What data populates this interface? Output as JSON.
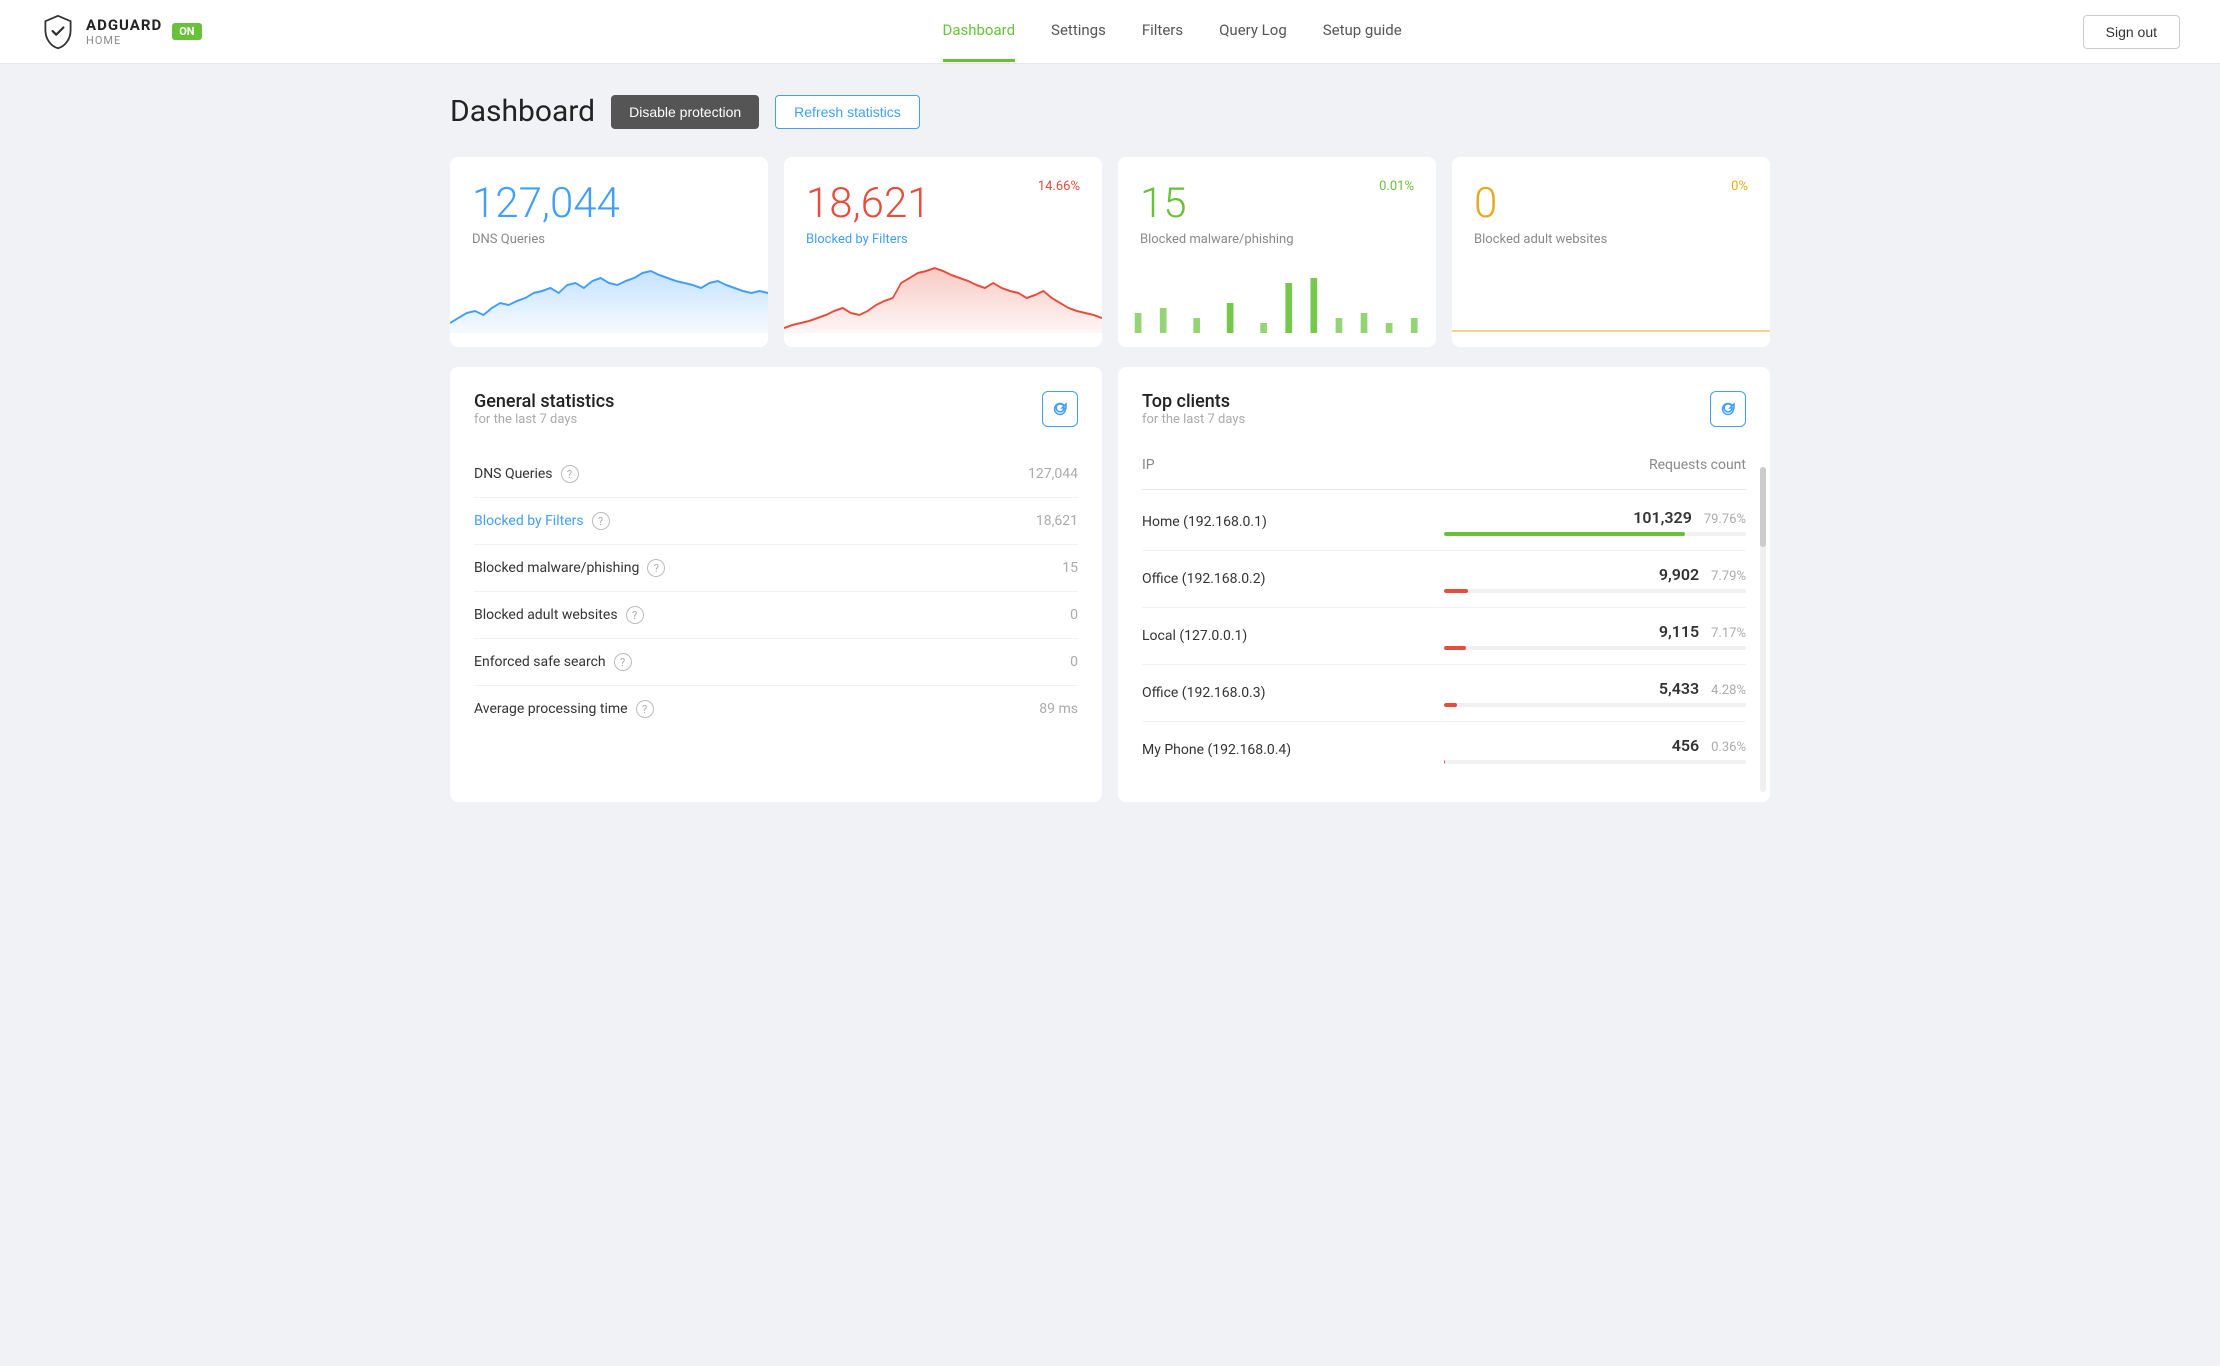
{
  "header": {
    "logo_name": "ADGUARD",
    "logo_sub": "HOME",
    "badge": "ON",
    "nav": [
      {
        "label": "Dashboard",
        "active": true
      },
      {
        "label": "Settings",
        "active": false
      },
      {
        "label": "Filters",
        "active": false
      },
      {
        "label": "Query Log",
        "active": false
      },
      {
        "label": "Setup guide",
        "active": false
      }
    ],
    "sign_out": "Sign out"
  },
  "page": {
    "title": "Dashboard",
    "btn_disable": "Disable protection",
    "btn_refresh": "Refresh statistics"
  },
  "stat_cards": [
    {
      "id": "dns-queries",
      "number": "127,044",
      "number_color": "blue",
      "percent": "",
      "percent_color": "",
      "label": "DNS Queries",
      "label_color": "",
      "chart_color": "#409eff",
      "chart_fill": "#ddeeff"
    },
    {
      "id": "blocked-filters",
      "number": "18,621",
      "number_color": "red",
      "percent": "14.66%",
      "percent_color": "red",
      "label": "Blocked by Filters",
      "label_color": "blue",
      "chart_color": "#e74c3c",
      "chart_fill": "#fde8e8"
    },
    {
      "id": "blocked-malware",
      "number": "15",
      "number_color": "green",
      "percent": "0.01%",
      "percent_color": "green",
      "label": "Blocked malware/phishing",
      "label_color": "",
      "chart_color": "#67c23a",
      "chart_fill": "#e8f8df"
    },
    {
      "id": "blocked-adult",
      "number": "0",
      "number_color": "yellow",
      "percent": "0%",
      "percent_color": "yellow",
      "label": "Blocked adult websites",
      "label_color": "",
      "chart_color": "#e6a817",
      "chart_fill": "#fdf3dc"
    }
  ],
  "general_stats": {
    "title": "General statistics",
    "subtitle": "for the last 7 days",
    "rows": [
      {
        "label": "DNS Queries",
        "value": "127,044",
        "is_link": false
      },
      {
        "label": "Blocked by Filters",
        "value": "18,621",
        "is_link": true
      },
      {
        "label": "Blocked malware/phishing",
        "value": "15",
        "is_link": false
      },
      {
        "label": "Blocked adult websites",
        "value": "0",
        "is_link": false
      },
      {
        "label": "Enforced safe search",
        "value": "0",
        "is_link": false
      },
      {
        "label": "Average processing time",
        "value": "89 ms",
        "is_link": false
      }
    ]
  },
  "top_clients": {
    "title": "Top clients",
    "subtitle": "for the last 7 days",
    "col_ip": "IP",
    "col_requests": "Requests count",
    "rows": [
      {
        "name": "Home (192.168.0.1)",
        "count": "101,329",
        "pct": "79.76%",
        "bar_pct": 79.76,
        "bar_color": "green"
      },
      {
        "name": "Office (192.168.0.2)",
        "count": "9,902",
        "pct": "7.79%",
        "bar_pct": 7.79,
        "bar_color": "red"
      },
      {
        "name": "Local (127.0.0.1)",
        "count": "9,115",
        "pct": "7.17%",
        "bar_pct": 7.17,
        "bar_color": "red"
      },
      {
        "name": "Office (192.168.0.3)",
        "count": "5,433",
        "pct": "4.28%",
        "bar_pct": 4.28,
        "bar_color": "red"
      },
      {
        "name": "My Phone (192.168.0.4)",
        "count": "456",
        "pct": "0.36%",
        "bar_pct": 0.36,
        "bar_color": "red"
      }
    ]
  }
}
